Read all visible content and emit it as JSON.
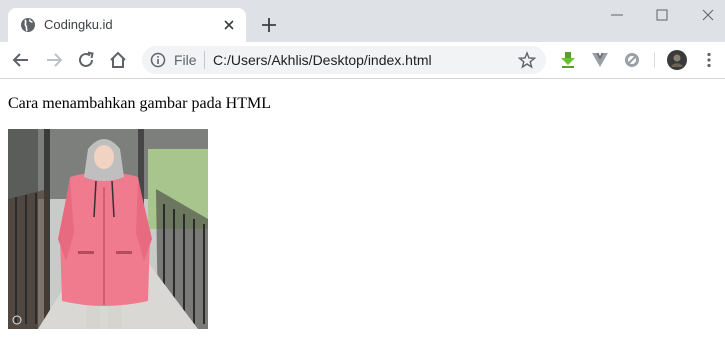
{
  "browser": {
    "tab": {
      "title": "Codingku.id",
      "favicon": "globe-icon"
    },
    "new_tab_icon": "plus-icon",
    "window_controls": [
      "minimize-icon",
      "maximize-icon",
      "close-icon"
    ],
    "nav": [
      "back-arrow-icon",
      "forward-arrow-icon",
      "reload-icon",
      "home-icon"
    ],
    "omnibox": {
      "security_label": "File",
      "url": "C:/Users/Akhlis/Desktop/index.html"
    },
    "extensions": [
      "download-arrow-icon",
      "vue-logo-icon",
      "blocked-icon"
    ],
    "accent": "#5f6368"
  },
  "page": {
    "heading": "Cara menambahkan gambar pada HTML",
    "image": {
      "subject": "photo of woman in pink jacket on walkway",
      "jacket_color": "#f07b8f"
    }
  }
}
